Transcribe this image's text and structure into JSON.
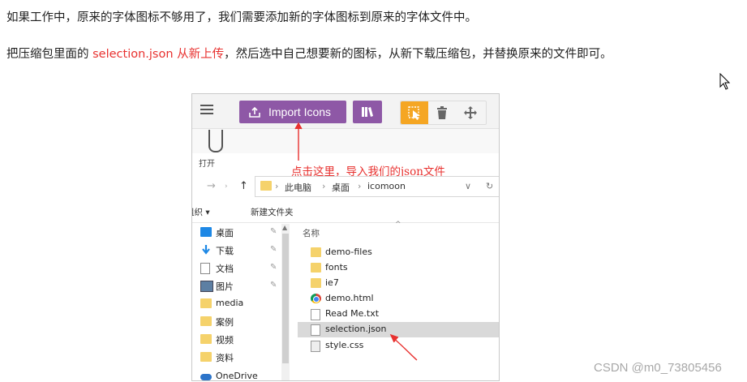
{
  "paragraphs": {
    "p1": "如果工作中，原来的字体图标不够用了，我们需要添加新的字体图标到原来的字体文件中。",
    "p2_before": "把压缩包里面的 ",
    "p2_highlight": "selection.json 从新上传",
    "p2_after": "，然后选中自己想要新的图标，从新下载压缩包，并替换原来的文件即可。"
  },
  "screenshot": {
    "import_button": "Import Icons",
    "open_label": "打开",
    "annotation": "点击这里，导入我们的json文件",
    "path": [
      "此电脑",
      "桌面",
      "icomoon"
    ],
    "actions": {
      "organize": "组织 ▾",
      "new_folder": "新建文件夹"
    },
    "sidebar": [
      {
        "label": "桌面",
        "icon": "desktop-icon",
        "pinned": true
      },
      {
        "label": "下载",
        "icon": "download-arrow-icon",
        "pinned": true
      },
      {
        "label": "文档",
        "icon": "document-icon",
        "pinned": true
      },
      {
        "label": "图片",
        "icon": "picture-icon",
        "pinned": true
      },
      {
        "label": "media",
        "icon": "folder-icon",
        "pinned": false
      },
      {
        "label": "案例",
        "icon": "folder-icon",
        "pinned": false
      },
      {
        "label": "视频",
        "icon": "folder-icon",
        "pinned": false
      },
      {
        "label": "资料",
        "icon": "folder-icon",
        "pinned": false
      },
      {
        "label": "OneDrive",
        "icon": "cloud-icon",
        "pinned": false
      }
    ],
    "column_header": "名称",
    "files": [
      {
        "name": "demo-files",
        "icon": "folder-icon"
      },
      {
        "name": "fonts",
        "icon": "folder-icon"
      },
      {
        "name": "ie7",
        "icon": "folder-icon"
      },
      {
        "name": "demo.html",
        "icon": "chrome-icon"
      },
      {
        "name": "Read Me.txt",
        "icon": "text-file-icon"
      },
      {
        "name": "selection.json",
        "icon": "json-file-icon",
        "selected": true
      },
      {
        "name": "style.css",
        "icon": "css-file-icon"
      }
    ]
  },
  "watermark": "CSDN @m0_73805456",
  "colors": {
    "accent_red": "#e8312f",
    "icomoon_purple": "#8e58a6",
    "icomoon_orange": "#f5a623"
  }
}
